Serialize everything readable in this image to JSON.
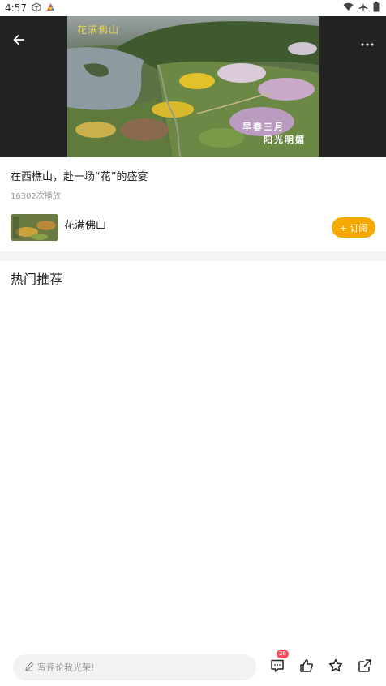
{
  "status_bar": {
    "time": "4:57",
    "icons": [
      "cube-icon",
      "color-triangle-icon",
      "wifi-icon",
      "airplane-icon",
      "battery-icon"
    ]
  },
  "player": {
    "overlay_title": "花满佛山",
    "caption_line1": "早春三月",
    "caption_line2": "阳光明媚",
    "icons": [
      "back-arrow-icon",
      "more-dots-icon"
    ]
  },
  "video": {
    "title": "在西樵山，赴一场“花”的盛宴",
    "play_count": "16302次播放"
  },
  "channel": {
    "name": "花满佛山",
    "subscribe_label": "+ 订阅",
    "accent_color": "#f5a800"
  },
  "section": {
    "title": "热门推荐"
  },
  "bottom_bar": {
    "comment_placeholder": "写评论我光荣!",
    "comment_count": "26",
    "badge_color": "#ff4d5f",
    "icons": [
      "pencil-icon",
      "comment-icon",
      "thumbs-up-icon",
      "star-icon",
      "share-icon"
    ]
  }
}
